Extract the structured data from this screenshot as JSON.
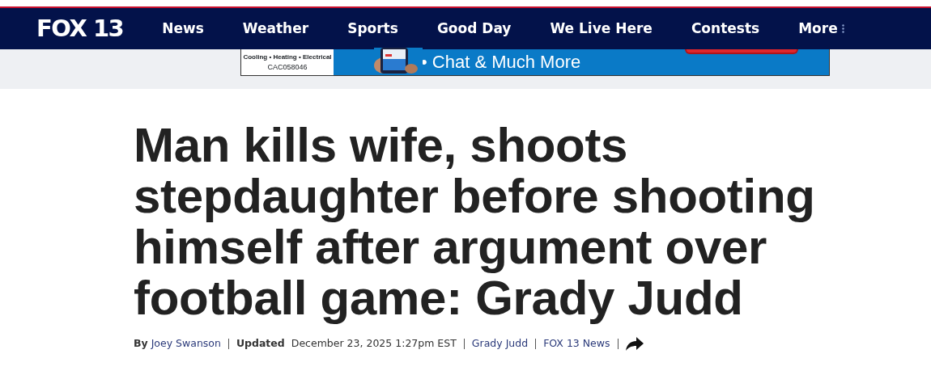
{
  "header": {
    "logo": "FOX 13",
    "nav": [
      {
        "label": "News"
      },
      {
        "label": "Weather"
      },
      {
        "label": "Sports"
      },
      {
        "label": "Good Day"
      },
      {
        "label": "We Live Here"
      },
      {
        "label": "Contests"
      },
      {
        "label": "More"
      }
    ]
  },
  "ad": {
    "services": "Cooling • Heating • Electrical",
    "license": "CAC058046",
    "bullet": "• Chat & Much More"
  },
  "article": {
    "headline": "Man kills wife, shoots stepdaughter before shooting himself after argument over football game: Grady Judd",
    "byline": {
      "by": "By",
      "author": "Joey Swanson",
      "updated_label": "Updated",
      "date": "December 23, 2025 1:27pm EST",
      "tags": [
        "Grady Judd",
        "FOX 13 News"
      ]
    }
  }
}
